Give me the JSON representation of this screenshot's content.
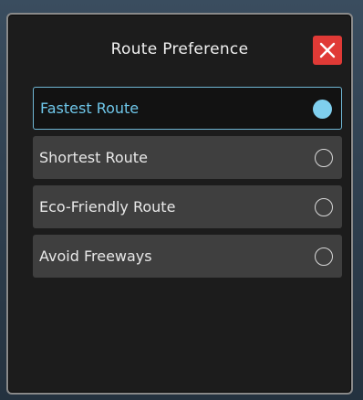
{
  "dialog": {
    "title": "Route Preference",
    "close_icon": "close-icon",
    "colors": {
      "close_button": "#e03a36",
      "selected_border": "#6fb6d3",
      "selected_text": "#6fc7ea",
      "selected_dot": "#7fcfee"
    }
  },
  "options": [
    {
      "label": "Fastest Route",
      "selected": true
    },
    {
      "label": "Shortest Route",
      "selected": false
    },
    {
      "label": "Eco-Friendly Route",
      "selected": false
    },
    {
      "label": "Avoid Freeways",
      "selected": false
    }
  ]
}
